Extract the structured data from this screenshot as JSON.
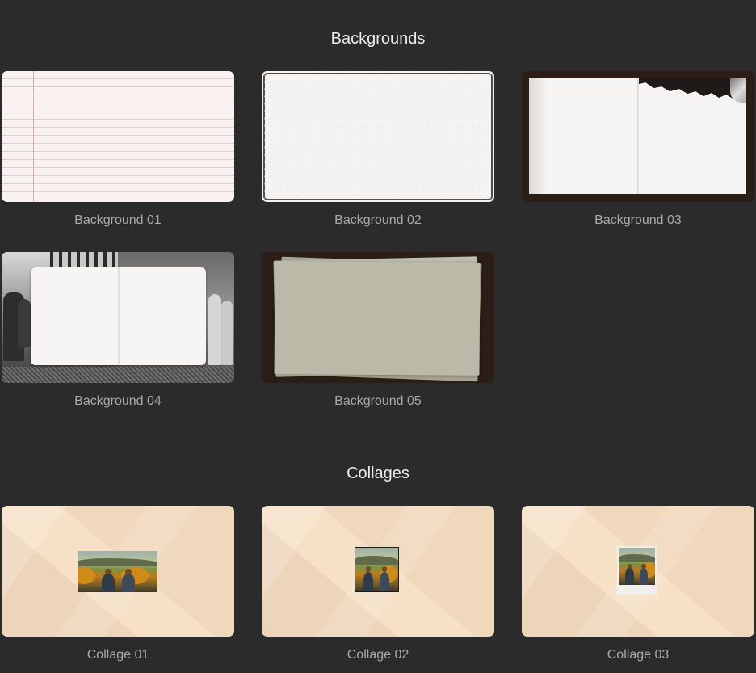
{
  "sections": {
    "backgrounds": {
      "title": "Backgrounds",
      "items": [
        {
          "label": "Background 01"
        },
        {
          "label": "Background 02"
        },
        {
          "label": "Background 03"
        },
        {
          "label": "Background 04"
        },
        {
          "label": "Background 05"
        }
      ]
    },
    "collages": {
      "title": "Collages",
      "items": [
        {
          "label": "Collage 01"
        },
        {
          "label": "Collage 02"
        },
        {
          "label": "Collage 03"
        }
      ]
    }
  },
  "colors": {
    "page_background": "#2c2b2b",
    "title_text": "#ececec",
    "caption_text": "#a9a9a9"
  }
}
